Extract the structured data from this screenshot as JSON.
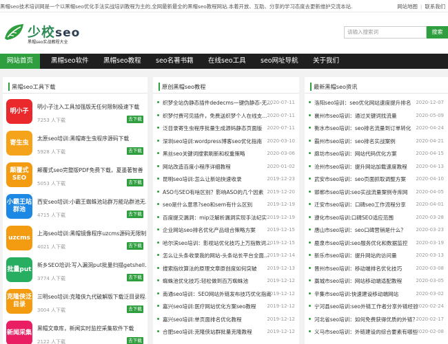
{
  "topbar": {
    "notice": "黑帽seo技术培训网是一个以黑帽seo优化手法实战培训教程为主的,全网最新最全的黑帽seo教程网站.本着开放、互助、分享的学习态度去更新维护交流本站.",
    "sitemap": "网站地图",
    "contact": "联系我们"
  },
  "header": {
    "brand_cn": "少校",
    "brand_latin": "seo",
    "slogan": "黑帽seo实战教程大全",
    "search_placeholder": "请输入搜索词",
    "search_button": "搜索",
    "colors": {
      "brand": "#2e8b57",
      "accent": "#2e9e3e"
    }
  },
  "nav": {
    "items": [
      "网站首页",
      "黑帽seo软件",
      "黑帽seo教程",
      "seo名著书籍",
      "在线seo工具",
      "seo网址导航",
      "关于我们"
    ]
  },
  "tools": {
    "title": "黑帽seo工具下载",
    "download_label": "去下载",
    "items": [
      {
        "thumb": "明小子",
        "color": "#e9292b",
        "name": "明小子注入工具加强版无任何限制极速下载",
        "downloads": "7253 人下载"
      },
      {
        "thumb": "寄生虫",
        "color": "#f5a31a",
        "name": "太原seo培训:黑帽寄生虫程序源码下载",
        "downloads": "5928 人下载"
      },
      {
        "thumb": "颠覆式SEO",
        "color": "#f39c12",
        "name": "颠覆式seo完整版PDF免费下载，夏墨著智善",
        "downloads": "5053 人下载"
      },
      {
        "thumb": "小霸王站群池",
        "color": "#1e88e5",
        "name": "西安seo培训:小霸王蜘蛛池站群万能站群池无...",
        "downloads": "4715 人下载"
      },
      {
        "thumb": "uzcms",
        "color": "#f39c12",
        "name": "上海seo培训:黑帽镜像程序uzcms源码无限制...",
        "downloads": "4021 人下载"
      },
      {
        "thumb": "批量put",
        "color": "#27ae60",
        "name": "新乡SEO培训:写入漏洞put批量扫描getshell...",
        "downloads": "3774 人下载"
      },
      {
        "thumb": "克隆侠泛目录",
        "color": "#f39c12",
        "name": "三明seo培训:克隆侠九代破解版下载泛目录程...",
        "downloads": "3004 人下载"
      },
      {
        "thumb": "新闻采集",
        "color": "#e91e63",
        "name": "黑帽文章库，新闻实时监控采集软件下载",
        "downloads": "2122 人下载"
      }
    ]
  },
  "tutorials": {
    "title": "原创黑帽seo教程",
    "items": [
      {
        "title": "织梦全站伪静态插件dedecms一键伪静态-无...",
        "date": "2020-07-11"
      },
      {
        "title": "织梦付费可见插件，免费送织梦个人在线支...",
        "date": "2020-07-11"
      },
      {
        "title": "泛目录寄生虫程序批量生成源码静态页面版",
        "date": "2020-07-11"
      },
      {
        "title": "深圳seo培训:wordpress博客seo优化指南",
        "date": "2020-03-10"
      },
      {
        "title": "黑丝seo关键词搜索刷新和权重策略",
        "date": "2020-03-06"
      },
      {
        "title": "网站改造百度小程序详细教程",
        "date": "2020-01-02"
      },
      {
        "title": "昆明seo培训:怎么让新站快速收录",
        "date": "2019-12-23"
      },
      {
        "title": "ASO与SEO有啥区别？影响ASO的几个因素",
        "date": "2019-12-20"
      },
      {
        "title": "seo是什么意思?seo和sem有什么区别",
        "date": "2019-12-19"
      },
      {
        "title": "百度提交漏洞：mip泛解析漏洞实现手法纪实",
        "date": "2019-12-19"
      },
      {
        "title": "企业网站seo排名优化产品组合策略方案",
        "date": "2019-12-15"
      },
      {
        "title": "哈尔滨seo培训：影视站优化技巧上万指数词...",
        "date": "2019-12-15"
      },
      {
        "title": "怎么让头条收录我的网站-头条站长平台全面...",
        "date": "2019-12-14"
      },
      {
        "title": "搜索指纹算法的原理文章原创度如何突破",
        "date": "2019-12-13"
      },
      {
        "title": "蜘蛛池优化技巧:轻松做到百万蜘蛛池",
        "date": "2019-12-12"
      },
      {
        "title": "南通seo培训：SEO网站外链发布技巧优化指南",
        "date": "2019-12-12"
      },
      {
        "title": "嘉兴seo培训:医疗网站优化方案seo教程",
        "date": "2019-12-12"
      },
      {
        "title": "嘉兴seo培训:单页面排名优化教程",
        "date": "2019-12-12"
      },
      {
        "title": "合肥seo培训:克隆侠站群批量克隆教程",
        "date": "2019-12-12"
      }
    ]
  },
  "news": {
    "title": "最新黑帽seo资讯",
    "items": [
      {
        "title": "洛阳seo培训：seo优化网站速度提升排名",
        "date": "2020-12-07"
      },
      {
        "title": "襄州市seo培训：通过关键词找流量",
        "date": "2020-05-09"
      },
      {
        "title": "衡水市seo培训：seo排名流量到订单转化",
        "date": "2020-04-24"
      },
      {
        "title": "霸州市seo培训：seo排名实战案例",
        "date": "2020-04-21"
      },
      {
        "title": "廊坊市seo培训：网站代码优化方案",
        "date": "2020-04-15"
      },
      {
        "title": "沧州市seo培训：提升网站加载速度教程",
        "date": "2020-04-13"
      },
      {
        "title": "武安市seo培训：seo页面抓取调整方案",
        "date": "2020-04-10"
      },
      {
        "title": "邯郸市seo培训:seo实战流量案例寺库网",
        "date": "2020-04-05"
      },
      {
        "title": "迁安市seo培训：口碑seo工作流程分享",
        "date": "2020-04-01"
      },
      {
        "title": "遵化市seo培训:口碑SEO适应范围",
        "date": "2020-03-28"
      },
      {
        "title": "唐山市seo培训：seo口碑营销是什么？",
        "date": "2020-03-23"
      },
      {
        "title": "鹿泉市seo培训:seo服务优化和数据监控",
        "date": "2020-03-19"
      },
      {
        "title": "新乐市seo培训：提升网站的访问量",
        "date": "2020-03-13"
      },
      {
        "title": "晋州市seo培训：移动端排名优化技巧",
        "date": "2020-03-08"
      },
      {
        "title": "藁城市seo培训：网站移动端适配教程",
        "date": "2020-03-05"
      },
      {
        "title": "辛集市seo培训:快速建设移动端网站",
        "date": "2020-03-02"
      },
      {
        "title": "宁河县seo培训:seo外链工作者分享外链经验",
        "date": "2020-02-24"
      },
      {
        "title": "河北省seo培训：如何免费获得优质的外链？",
        "date": "2020-02-17"
      },
      {
        "title": "义马市seo培训：外链建设的综合要素有哪些？",
        "date": "2020-02-08"
      }
    ]
  }
}
